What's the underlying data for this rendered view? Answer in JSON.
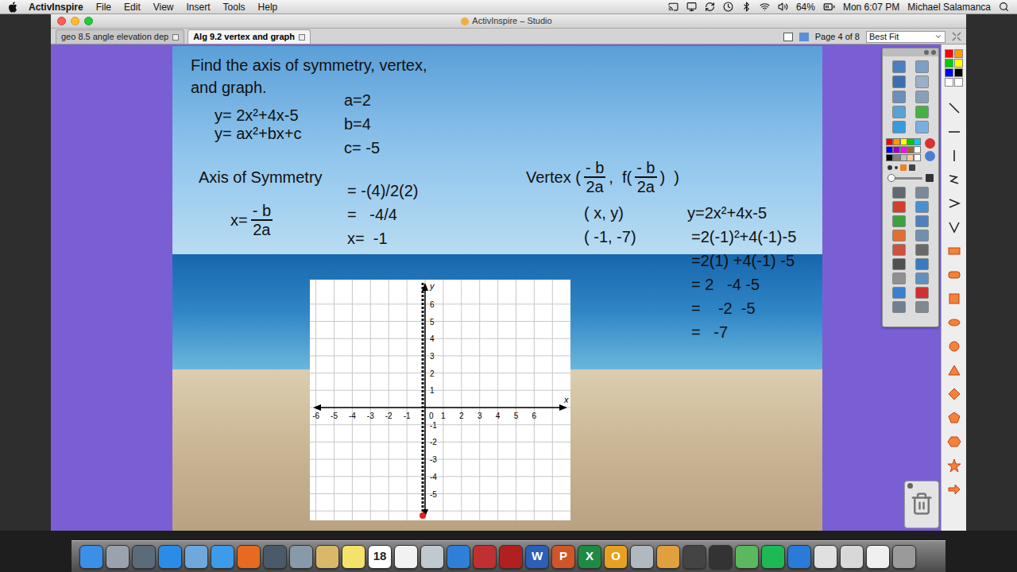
{
  "menu_bar": {
    "app": "ActivInspire",
    "items": [
      "File",
      "Edit",
      "View",
      "Insert",
      "Tools",
      "Help"
    ],
    "battery": "64%",
    "clock": "Mon 6:07 PM",
    "user": "Michael Salamanca"
  },
  "window": {
    "title": "ActivInspire – Studio"
  },
  "tabs": [
    {
      "label": "geo 8.5 angle elevation dep",
      "selected": false
    },
    {
      "label": "Alg 9.2 vertex and graph",
      "selected": true
    }
  ],
  "page_indicator": "Page 4 of 8",
  "zoom": {
    "value": "Best Fit"
  },
  "slide": {
    "title_lines": [
      "Find the axis of symmetry, vertex,",
      "and graph."
    ],
    "equations": [
      "y= 2x²+4x-5",
      "y= ax²+bx+c"
    ],
    "coefficients": [
      "a=2",
      "b=4",
      "c= -5"
    ],
    "axis": {
      "heading": "Axis of Symmetry",
      "lhs": "x=",
      "num": "- b",
      "den": "2a",
      "steps": [
        "= -(4)/2(2)",
        "=   -4/4",
        "x=  -1"
      ]
    },
    "vertex": {
      "label": "Vertex (",
      "num": "- b",
      "den": "2a",
      "mid": ",  f(",
      "num2": "- b",
      "den2": "2a",
      "close": ")  )",
      "points": [
        "( x, y)",
        "( -1, -7)"
      ],
      "work": [
        "y=2x²+4x-5",
        "=2(-1)²+4(-1)-5",
        "=2(1) +4(-1) -5",
        "= 2   -4 -5",
        "=    -2  -5",
        "=   -7"
      ]
    }
  },
  "graph": {
    "x_label": "x",
    "y_label": "y",
    "origin_label": "0",
    "x_ticks": [
      "-6",
      "-5",
      "-4",
      "-3",
      "-2",
      "-1",
      "1",
      "2",
      "3",
      "4",
      "5",
      "6"
    ],
    "y_ticks": [
      "6",
      "5",
      "4",
      "3",
      "2",
      "1",
      "-1",
      "-2",
      "-3",
      "-4",
      "-5"
    ]
  },
  "toolbox": {
    "palette": [
      "#ff0000",
      "#ff9900",
      "#ffff00",
      "#00cc00",
      "#00ccff",
      "#0000ff",
      "#9900cc",
      "#ff00ff",
      "#996633",
      "#ffffff",
      "#000000",
      "#808080",
      "#c0c0c0",
      "#ffcc99",
      "#ffffff"
    ]
  },
  "side_palette": [
    "#ff0000",
    "#ff9900",
    "#00cc00",
    "#ffff00",
    "#0000ff",
    "#000000",
    "#ffffff",
    "#ffffff"
  ],
  "shape_tools": [
    "line",
    "hline",
    "vline",
    "zigzag",
    "wedge",
    "vee",
    "rectangle",
    "rounded",
    "square",
    "ellipse",
    "circle",
    "triangle",
    "diamond",
    "pentagon",
    "hexagon",
    "star",
    "arrow"
  ],
  "dock": [
    {
      "color": "#3b8fe6",
      "glyph": ""
    },
    {
      "color": "#9aa3ad",
      "glyph": ""
    },
    {
      "color": "#5a6b7a",
      "glyph": ""
    },
    {
      "color": "#2b8be6",
      "glyph": ""
    },
    {
      "color": "#6fa8dc",
      "glyph": ""
    },
    {
      "color": "#3d9be9",
      "glyph": ""
    },
    {
      "color": "#e66a1f",
      "glyph": ""
    },
    {
      "color": "#4a5a6a",
      "glyph": ""
    },
    {
      "color": "#8899aa",
      "glyph": ""
    },
    {
      "color": "#d9b86a",
      "glyph": ""
    },
    {
      "color": "#f4e36a",
      "glyph": ""
    },
    {
      "color": "#ffffff",
      "glyph": "18"
    },
    {
      "color": "#f2f2f2",
      "glyph": ""
    },
    {
      "color": "#c0c8d0",
      "glyph": ""
    },
    {
      "color": "#2f7fd8",
      "glyph": ""
    },
    {
      "color": "#c03030",
      "glyph": ""
    },
    {
      "color": "#b02020",
      "glyph": ""
    },
    {
      "color": "#2b5fb8",
      "glyph": "W"
    },
    {
      "color": "#d0562a",
      "glyph": "P"
    },
    {
      "color": "#1f8a44",
      "glyph": "X"
    },
    {
      "color": "#e8a020",
      "glyph": "O"
    },
    {
      "color": "#b0b8c0",
      "glyph": ""
    },
    {
      "color": "#e0a040",
      "glyph": ""
    },
    {
      "color": "#444444",
      "glyph": ""
    },
    {
      "color": "#333333",
      "glyph": ""
    },
    {
      "color": "#5cb85c",
      "glyph": ""
    },
    {
      "color": "#1db954",
      "glyph": ""
    },
    {
      "color": "#2a7ad8",
      "glyph": ""
    },
    {
      "color": "#e0e0e0",
      "glyph": ""
    },
    {
      "color": "#d8d8d8",
      "glyph": ""
    },
    {
      "color": "#f0f0f0",
      "glyph": ""
    },
    {
      "color": "#9a9a9a",
      "glyph": ""
    }
  ]
}
